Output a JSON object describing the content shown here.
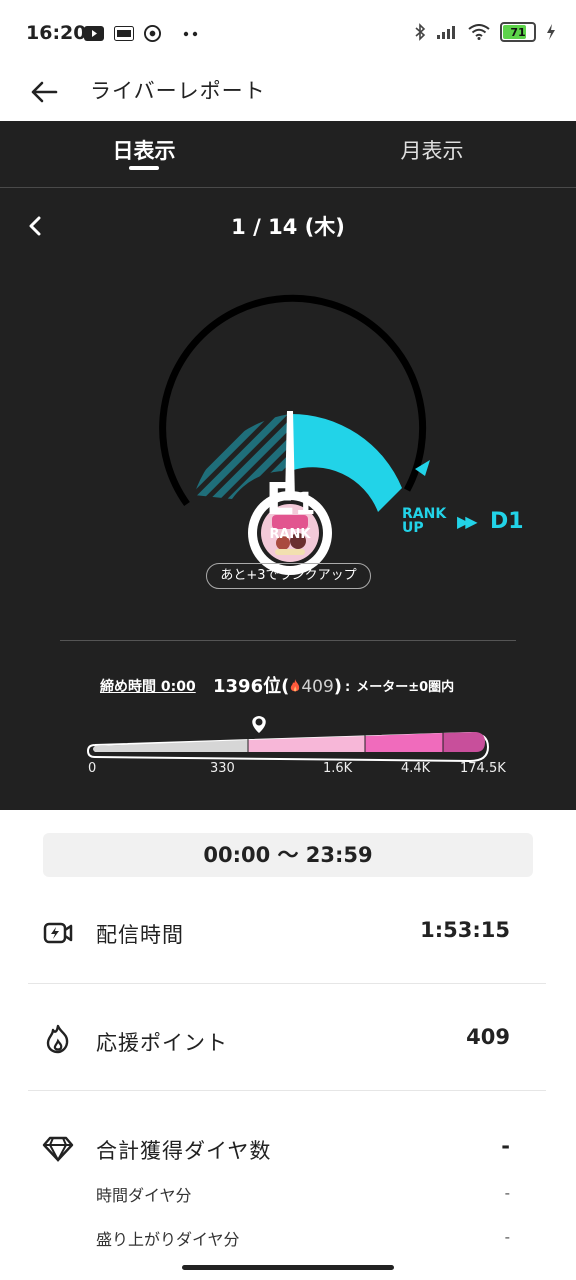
{
  "status_bar": {
    "time": "16:20",
    "icons_left": [
      "youtube-icon",
      "ge-icon",
      "chrome-icon",
      "more-dots-icon"
    ],
    "icons_right": [
      "bluetooth-icon",
      "signal-icon",
      "wifi-icon",
      "battery-icon",
      "charging-icon"
    ],
    "battery_level": "71",
    "battery_fraction": 0.71
  },
  "app_bar": {
    "title": "ライバーレポート"
  },
  "tabs": {
    "day": "日表示",
    "month": "月表示",
    "active": "day"
  },
  "date": {
    "label": "1 / 14 (木)"
  },
  "gauge": {
    "progress_fraction": 0.6,
    "colors": {
      "accent": "#22d3e8",
      "dark_teal": "#157a89",
      "track": "#000000"
    }
  },
  "rank": {
    "letter": "E",
    "number": "1",
    "caption": "RANK",
    "rankup_line1": "RANK",
    "rankup_line2": "UP",
    "rankup_arrows": "▶▶",
    "next_rank": "D1",
    "remaining_pill": "あと+3でランクアップ"
  },
  "deadline": {
    "label": "締め時間 0:00",
    "position": "1396位(",
    "points": "409",
    "position_close": ")",
    "separator": ":",
    "meter_note": "メーター±0圏内"
  },
  "meter": {
    "marker_fraction": 0.345,
    "labels": [
      "0",
      "330",
      "1.6K",
      "4.4K",
      "174.5K"
    ],
    "colors": [
      "#d6d6d6",
      "#f7b7d8",
      "#f06bbc",
      "#c84f9b"
    ]
  },
  "time_range": "00:00 〜 23:59",
  "stats": {
    "stream_time": {
      "label": "配信時間",
      "value": "1:53:15"
    },
    "support_points": {
      "label": "応援ポイント",
      "value": "409"
    },
    "diamonds": {
      "label": "合計獲得ダイヤ数",
      "value": "-",
      "sub": [
        {
          "label": "時間ダイヤ分",
          "value": "-"
        },
        {
          "label": "盛り上がりダイヤ分",
          "value": "-"
        }
      ]
    }
  }
}
